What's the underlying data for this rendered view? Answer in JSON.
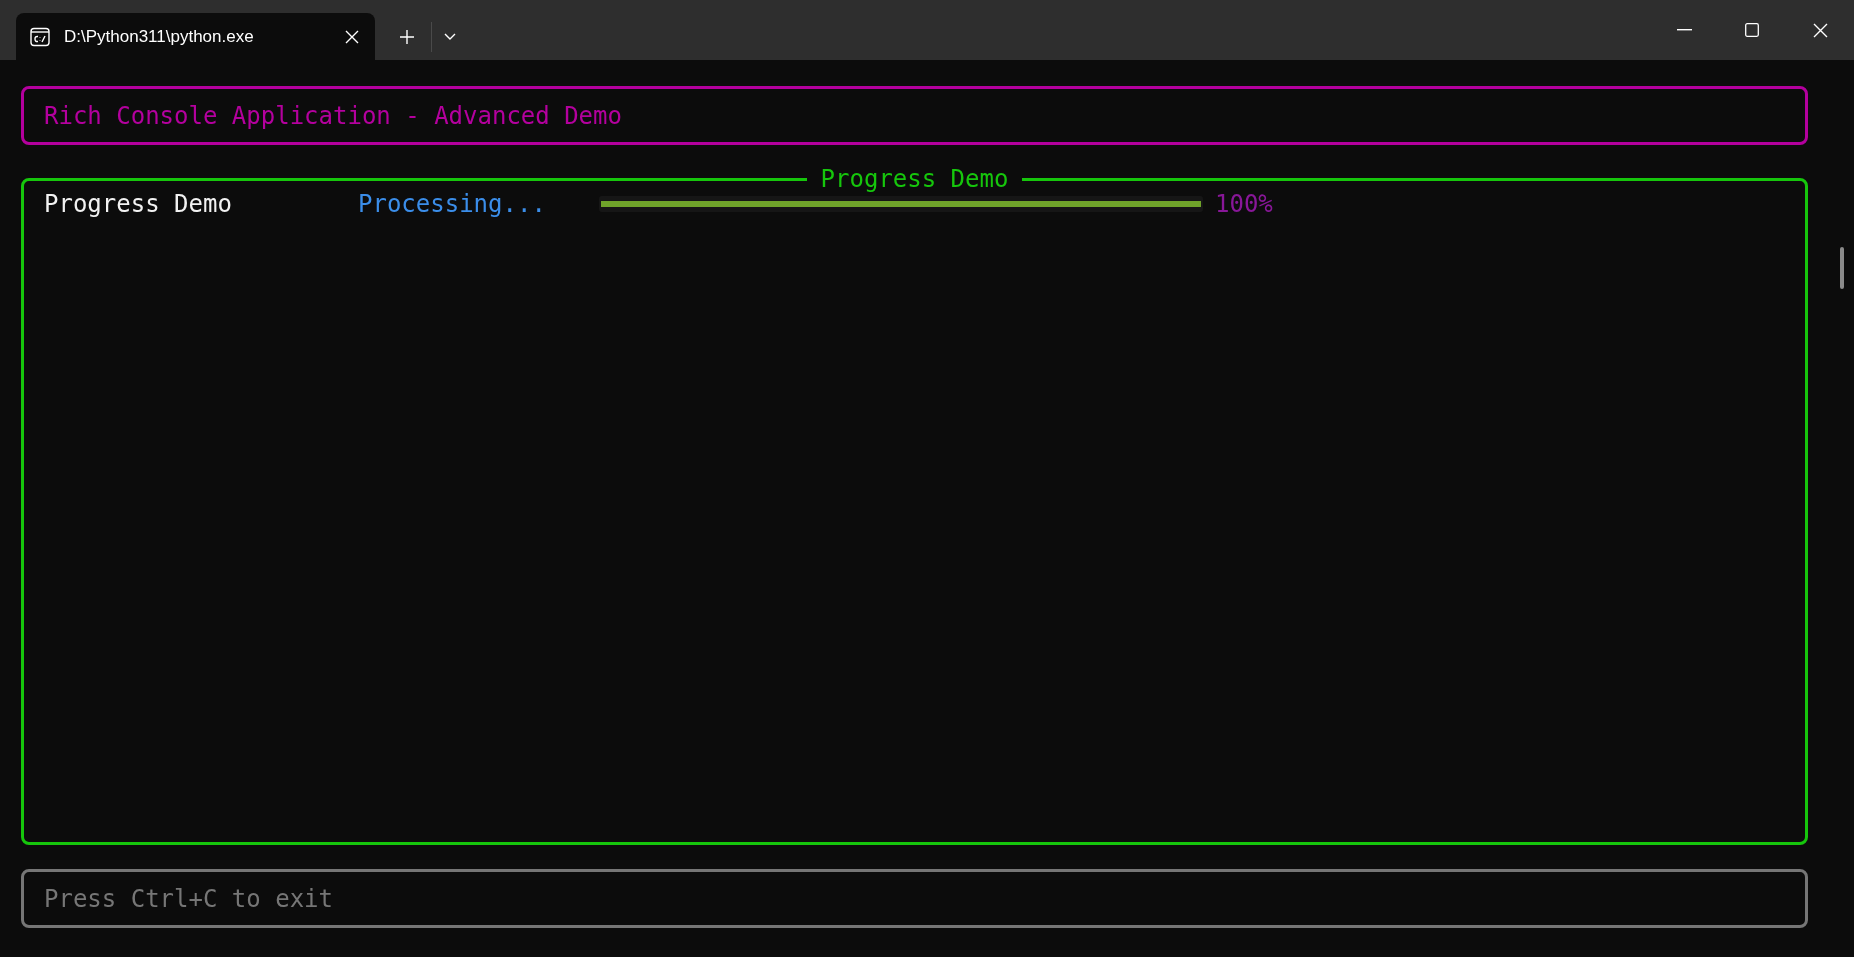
{
  "tabs": [
    {
      "title": "D:\\Python311\\python.exe",
      "selected": true
    }
  ],
  "header": {
    "title": "Rich Console Application - Advanced Demo"
  },
  "panel": {
    "title": "Progress Demo",
    "tasks": [
      {
        "name": "Progress Demo",
        "status": "Processing...",
        "level": 1,
        "percent": "100%"
      }
    ]
  },
  "footer": {
    "text": "Press Ctrl+C to exit"
  }
}
